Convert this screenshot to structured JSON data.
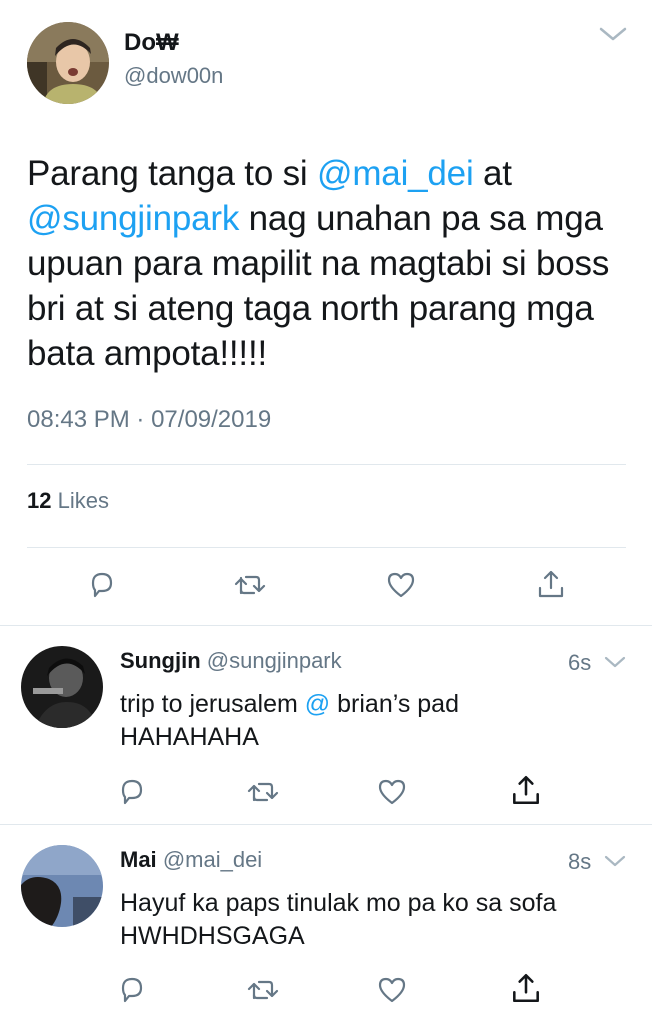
{
  "main_tweet": {
    "display_name": "Do₩",
    "handle": "@dow00n",
    "text_part1": "Parang tanga to si ",
    "mention1": "@mai_dei",
    "text_part2": " at ",
    "mention2": "@sungjinpark",
    "text_part3": " nag unahan pa sa mga upuan para mapilit na magtabi si boss bri at si ateng taga north parang mga bata ampota!!!!!",
    "time": "08:43 PM",
    "separator": "·",
    "date": "07/09/2019",
    "likes_count": "12",
    "likes_label": "Likes"
  },
  "replies": [
    {
      "display_name": "Sungjin",
      "handle": "@sungjinpark",
      "time": "6s",
      "text_before": "trip to jerusalem ",
      "mention": "@",
      "text_after": " brian’s pad HAHAHAHA"
    },
    {
      "display_name": "Mai",
      "handle": "@mai_dei",
      "time": "8s",
      "text": "Hayuf ka paps tinulak mo pa ko sa sofa HWHDHSGAGA"
    }
  ],
  "icons": {
    "reply": "reply-icon",
    "retweet": "retweet-icon",
    "like": "heart-icon",
    "share": "share-icon",
    "caret": "chevron-down-icon"
  },
  "colors": {
    "link": "#1da1f2",
    "muted": "#657786",
    "text": "#14171a",
    "divider": "#e1e8ed"
  }
}
